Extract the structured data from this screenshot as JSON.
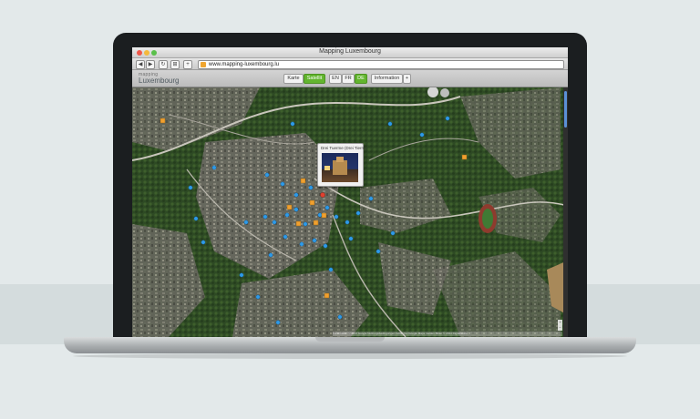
{
  "window": {
    "title": "Mapping Luxembourg"
  },
  "browser": {
    "back_label": "◀",
    "forward_label": "▶",
    "reload_label": "↻",
    "bookmark_label": "⊞",
    "add_label": "+",
    "url": "www.mapping-luxembourg.lu"
  },
  "app": {
    "logo_top": "mapping",
    "logo_main": "Luxembourg",
    "buttons": {
      "karte": "Karte",
      "satellit": "Satellit",
      "en": "EN",
      "fr": "FR",
      "de": "DE",
      "information": "Information",
      "more": "+"
    }
  },
  "map": {
    "popup_title": "Drei Tuerme (Drei Tierm)",
    "attribution": "Kartendaten © 2014 Google  Nutzungsbedingungen  Fehler bei Google Maps melden  Bilder © 2014 DigitalGlobe",
    "pin_colors": {
      "blue": "#2f9be8",
      "orange": "#f0a030",
      "red": "#e04030"
    },
    "icons": [
      "map-pin-icon",
      "zoom-icon"
    ]
  }
}
